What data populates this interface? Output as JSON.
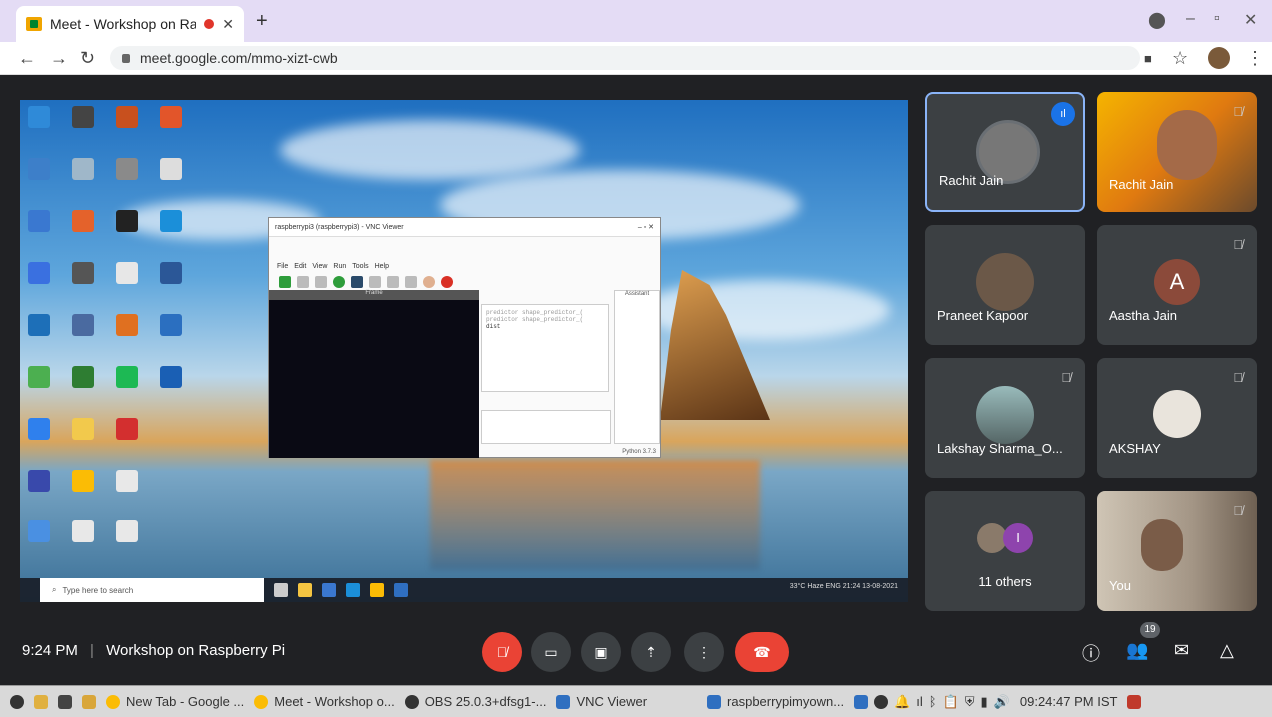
{
  "browser": {
    "tab_title": "Meet - Workshop on Rasp",
    "tab_close": "✕",
    "new_tab": "+",
    "url": "meet.google.com/mmo-xizt-cwb"
  },
  "presentation": {
    "vnc_title": "raspberrypi3 (raspberrypi3) - VNC Viewer",
    "vnc_menu": [
      "File",
      "Edit",
      "View",
      "Run",
      "Tools",
      "Help"
    ],
    "frame_title": "Frame",
    "code_lines": [
      "predictor shape_predictor_(",
      "predictor shape_predictor_(",
      "",
      "dist"
    ],
    "assistant_label": "Assistant",
    "status": "Python 3.7.3",
    "win_search_placeholder": "Type here to search",
    "win_tray": "33°C Haze  ENG  21:24  13-08-2021"
  },
  "participants": [
    {
      "name": "Rachit Jain",
      "speaking": true
    },
    {
      "name": "Rachit Jain",
      "muted": true
    },
    {
      "name": "Praneet Kapoor"
    },
    {
      "name": "Aastha Jain",
      "initial": "A",
      "muted": true
    },
    {
      "name": "Lakshay Sharma_O...",
      "muted": true
    },
    {
      "name": "AKSHAY",
      "muted": true
    },
    {
      "name": "11 others",
      "initial": "I"
    },
    {
      "name": "You",
      "muted": true
    }
  ],
  "meeting": {
    "time": "9:24 PM",
    "separator": "|",
    "title": "Workshop on Raspberry Pi",
    "people_count": "19"
  },
  "taskbar": {
    "items": [
      "New Tab - Google ...",
      "Meet - Workshop o...",
      "OBS 25.0.3+dfsg1-...",
      "VNC Viewer",
      "raspberrypimyown..."
    ],
    "clock": "09:24:47 PM IST"
  },
  "colors": {
    "accent_blue": "#8ab4f8",
    "end_call_red": "#ea4335",
    "tile_bg": "#3c4043"
  }
}
